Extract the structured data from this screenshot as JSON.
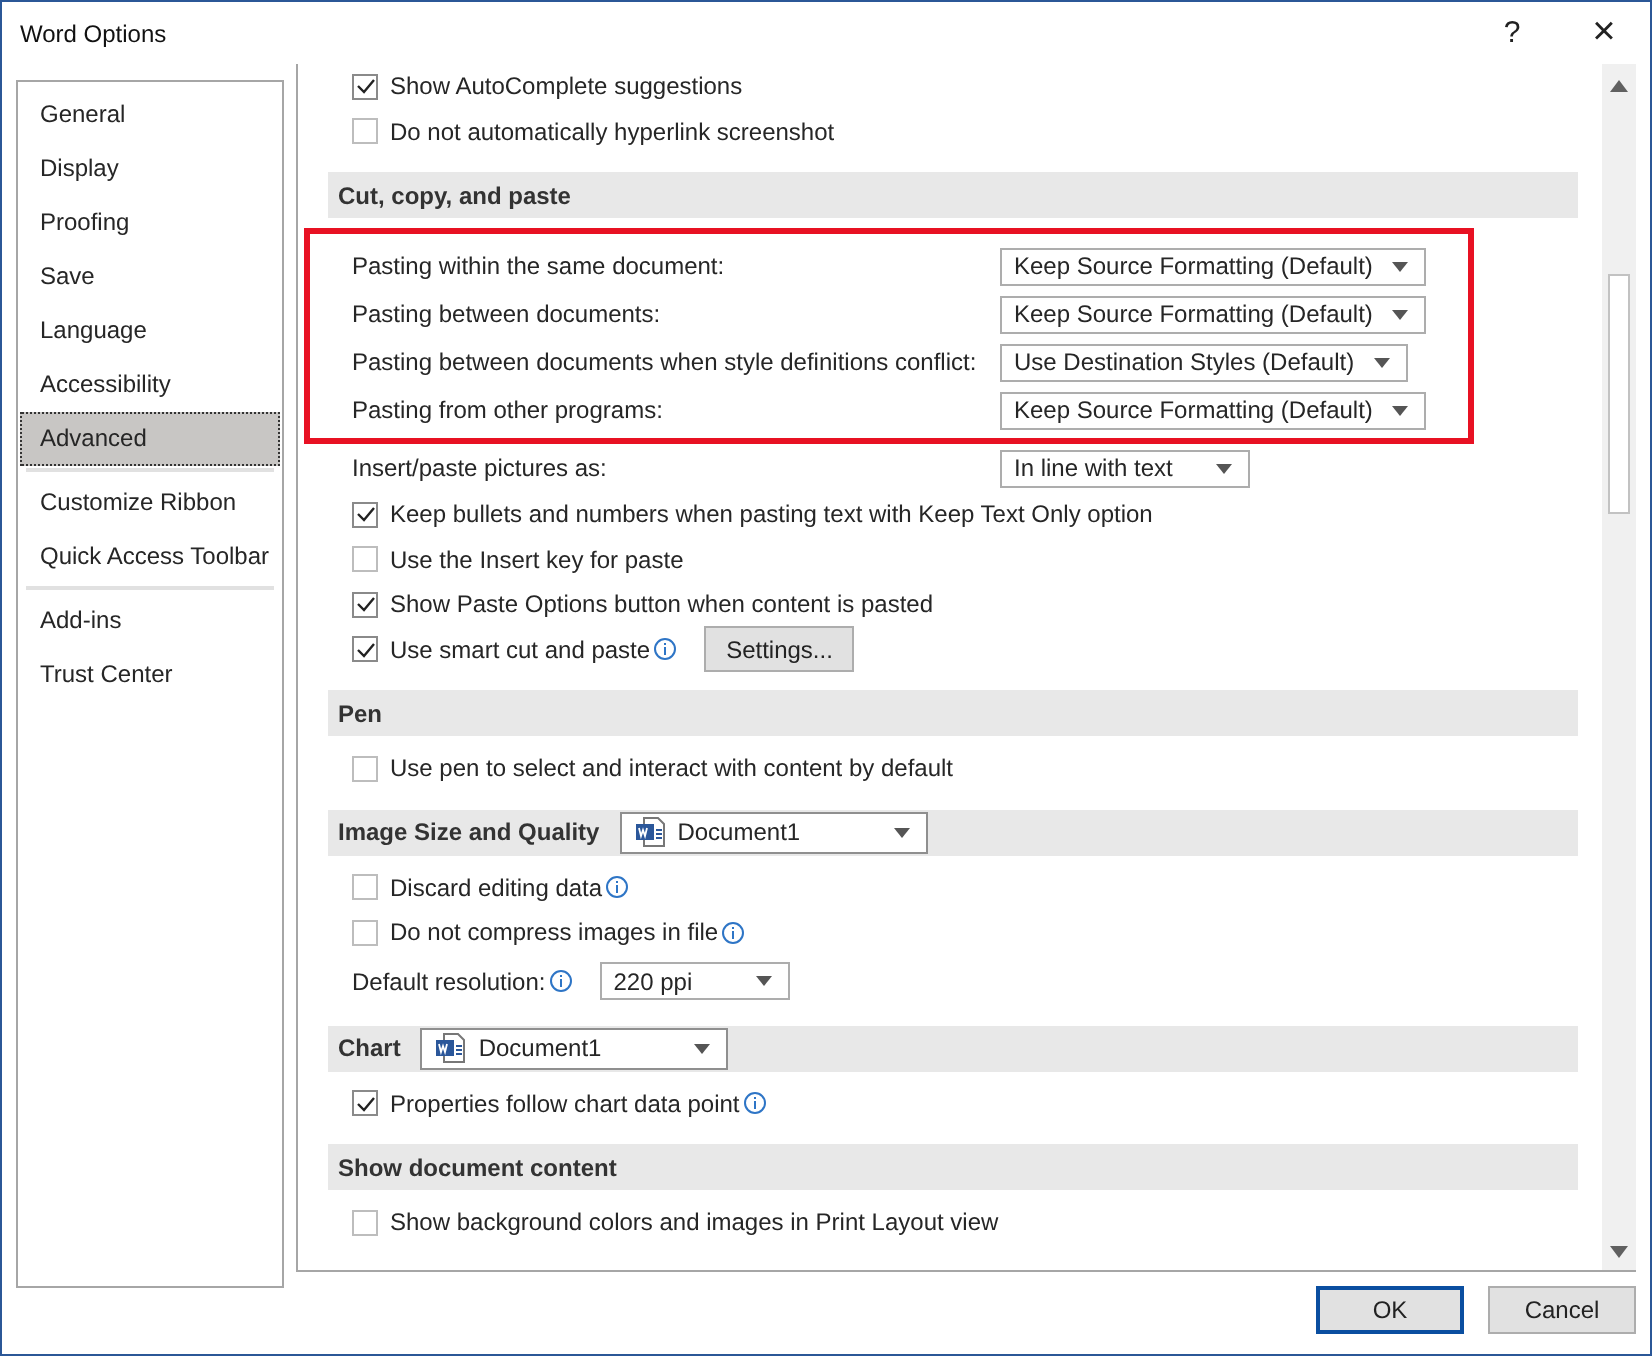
{
  "window": {
    "title": "Word Options",
    "help": "?",
    "close": "×"
  },
  "sidebar": {
    "groups": [
      [
        {
          "label": "General",
          "selected": false
        },
        {
          "label": "Display",
          "selected": false
        },
        {
          "label": "Proofing",
          "selected": false
        },
        {
          "label": "Save",
          "selected": false
        },
        {
          "label": "Language",
          "selected": false
        },
        {
          "label": "Accessibility",
          "selected": false
        },
        {
          "label": "Advanced",
          "selected": true
        }
      ],
      [
        {
          "label": "Customize Ribbon",
          "selected": false
        },
        {
          "label": "Quick Access Toolbar",
          "selected": false
        }
      ],
      [
        {
          "label": "Add-ins",
          "selected": false
        },
        {
          "label": "Trust Center",
          "selected": false
        }
      ]
    ]
  },
  "content": [
    {
      "kind": "checkbox",
      "label": "Show AutoComplete suggestions",
      "checked": true
    },
    {
      "kind": "checkbox",
      "label": "Do not automatically hyperlink screenshot",
      "checked": false
    },
    {
      "kind": "section",
      "title": "Cut, copy, and paste"
    },
    {
      "kind": "highlight",
      "rows": [
        {
          "label": "Pasting within the same document:",
          "value": "Keep Source Formatting (Default)"
        },
        {
          "label": "Pasting between documents:",
          "value": "Keep Source Formatting (Default)"
        },
        {
          "label": "Pasting between documents when style definitions conflict:",
          "value": "Use Destination Styles (Default)"
        },
        {
          "label": "Pasting from other programs:",
          "value": "Keep Source Formatting (Default)"
        }
      ]
    },
    {
      "kind": "select",
      "label": "Insert/paste pictures as:",
      "value": "In line with text"
    },
    {
      "kind": "checkbox",
      "label": "Keep bullets and numbers when pasting text with Keep Text Only option",
      "checked": true
    },
    {
      "kind": "checkbox",
      "label": "Use the Insert key for paste",
      "checked": false
    },
    {
      "kind": "checkbox",
      "label": "Show Paste Options button when content is pasted",
      "checked": true
    },
    {
      "kind": "checkbox",
      "label": "Use smart cut and paste",
      "checked": true,
      "info": true,
      "button": "Settings..."
    },
    {
      "kind": "section",
      "title": "Pen"
    },
    {
      "kind": "checkbox",
      "label": "Use pen to select and interact with content by default",
      "checked": false
    },
    {
      "kind": "section",
      "title": "Image Size and Quality",
      "document": "Document1"
    },
    {
      "kind": "checkbox",
      "label": "Discard editing data",
      "checked": false,
      "info": true
    },
    {
      "kind": "checkbox",
      "label": "Do not compress images in file",
      "checked": false,
      "info": true
    },
    {
      "kind": "resolution",
      "label": "Default resolution:",
      "value": "220 ppi",
      "info": true
    },
    {
      "kind": "section",
      "title": "Chart",
      "document": "Document1"
    },
    {
      "kind": "checkbox",
      "label": "Properties follow chart data point",
      "checked": true,
      "info": true
    },
    {
      "kind": "section",
      "title": "Show document content"
    },
    {
      "kind": "checkbox",
      "label": "Show background colors and images in Print Layout view",
      "checked": false
    }
  ],
  "buttons": [
    {
      "label": "OK",
      "default": true
    },
    {
      "label": "Cancel",
      "default": false
    }
  ]
}
